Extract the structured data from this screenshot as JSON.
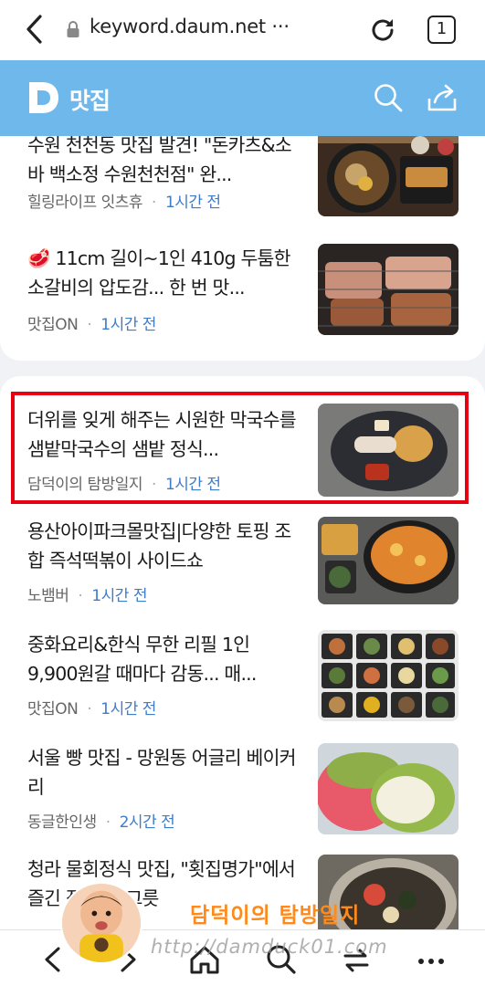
{
  "browser": {
    "url": "keyword.daum.net ···",
    "tab_count": "1"
  },
  "header": {
    "logo_letter": "D",
    "title": "맛집",
    "brand_color": "#6fb8ec"
  },
  "top_articles": [
    {
      "title": "수원 천천동 맛집 발견! \"돈카츠&소바 백소정 수원천천점\" 완...",
      "source": "힐링라이프 잇츠휴",
      "time": "1시간 전",
      "thumb": "tonkatsu-soba-photo"
    },
    {
      "title": "🥩 11cm 길이~1인 410g 두툼한 소갈비의 압도감... 한 번 맛...",
      "source": "맛집ON",
      "time": "1시간 전",
      "thumb": "grilled-galbi-photo"
    }
  ],
  "main_articles": [
    {
      "title": "더위를 잊게 해주는 시원한 막국수를 샘밭막국수의 샘밭 정식...",
      "source": "담덕이의 탐방일지",
      "time": "1시간 전",
      "thumb": "makguksu-platter-photo",
      "highlighted": true
    },
    {
      "title": "용산아이파크몰맛집|다양한 토핑 조합 즉석떡볶이 사이드쇼",
      "source": "노뱀버",
      "time": "1시간 전",
      "thumb": "tteokbokki-pot-photo"
    },
    {
      "title": "중화요리&한식 무한 리필 1인 9,900원갈 때마다 감동... 매...",
      "source": "맛집ON",
      "time": "1시간 전",
      "thumb": "buffet-dishes-photo"
    },
    {
      "title": "서울 빵 맛집 - 망원동 어글리 베이커리",
      "source": "동글한인생",
      "time": "2시간 전",
      "thumb": "bread-photo"
    },
    {
      "title": "청라 물회정식 맛집, \"횟집명가\"에서 즐긴 점심 한 그릇",
      "source": "",
      "time": "",
      "thumb": "mulhoe-photo"
    }
  ],
  "watermark": {
    "blog_name": "담덕이의 탐방일지",
    "blog_url": "http://damduck01.com"
  },
  "highlight_color": "#e60012",
  "time_color": "#3f7cc8"
}
